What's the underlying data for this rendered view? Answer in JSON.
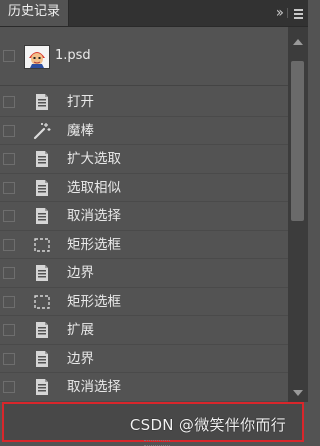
{
  "panel": {
    "title": "历史记录"
  },
  "snapshot": {
    "label": "1.psd",
    "checked": false
  },
  "history_items": [
    {
      "label": "打开",
      "icon": "document-icon"
    },
    {
      "label": "魔棒",
      "icon": "magic-wand-icon"
    },
    {
      "label": "扩大选取",
      "icon": "document-icon"
    },
    {
      "label": "选取相似",
      "icon": "document-icon"
    },
    {
      "label": "取消选择",
      "icon": "document-icon"
    },
    {
      "label": "矩形选框",
      "icon": "marquee-icon"
    },
    {
      "label": "边界",
      "icon": "document-icon"
    },
    {
      "label": "矩形选框",
      "icon": "marquee-icon"
    },
    {
      "label": "扩展",
      "icon": "document-icon"
    },
    {
      "label": "边界",
      "icon": "document-icon"
    },
    {
      "label": "取消选择",
      "icon": "document-icon"
    }
  ],
  "watermark": "CSDN @微笑伴你而行",
  "colors": {
    "panel_bg": "#535353",
    "tabbar_bg": "#323232",
    "highlight_border": "#d9262b"
  }
}
